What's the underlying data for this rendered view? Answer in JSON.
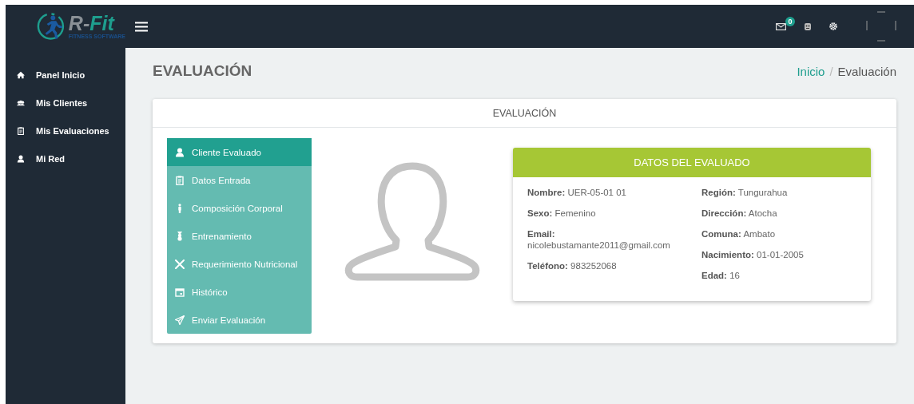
{
  "brand": {
    "name": "R-Fit",
    "tagline": "FITNESS SOFTWARE"
  },
  "topbar": {
    "mail_count": "0"
  },
  "sidebar": {
    "items": [
      {
        "label": "Panel Inicio",
        "selected": false
      },
      {
        "label": "Mis Clientes",
        "selected": false
      },
      {
        "label": "Mis Evaluaciones",
        "selected": false
      },
      {
        "label": "Mi Red",
        "selected": false
      }
    ]
  },
  "page": {
    "title": "EVALUACIÓN",
    "breadcrumb_separator": "/",
    "breadcrumb": [
      {
        "label": "Inicio",
        "kind": "link"
      },
      {
        "label": "Evaluación",
        "kind": "current"
      }
    ]
  },
  "card": {
    "title": "EVALUACIÓN",
    "menu": [
      {
        "label": "Cliente Evaluado",
        "selected": true
      },
      {
        "label": "Datos Entrada",
        "selected": false
      },
      {
        "label": "Composición Corporal",
        "selected": false
      },
      {
        "label": "Entrenamiento",
        "selected": false
      },
      {
        "label": "Requerimiento Nutricional",
        "selected": false
      },
      {
        "label": "Histórico",
        "selected": false
      },
      {
        "label": "Enviar Evaluación",
        "selected": false
      }
    ],
    "details": {
      "title": "DATOS DEL EVALUADO",
      "columns": [
        [
          "**Nombre:** UER-05-01 01",
          "**Sexo:** Femenino",
          "**Email:** nicolebustamante2011@gmail.com",
          "**Teléfono:** 983252068"
        ],
        [
          "**Región:** Tungurahua",
          "**Dirección:** Atocha",
          "**Comuna:** Ambato",
          "**Nacimiento:** 01-01-2005",
          "**Edad:** 16"
        ]
      ]
    }
  }
}
